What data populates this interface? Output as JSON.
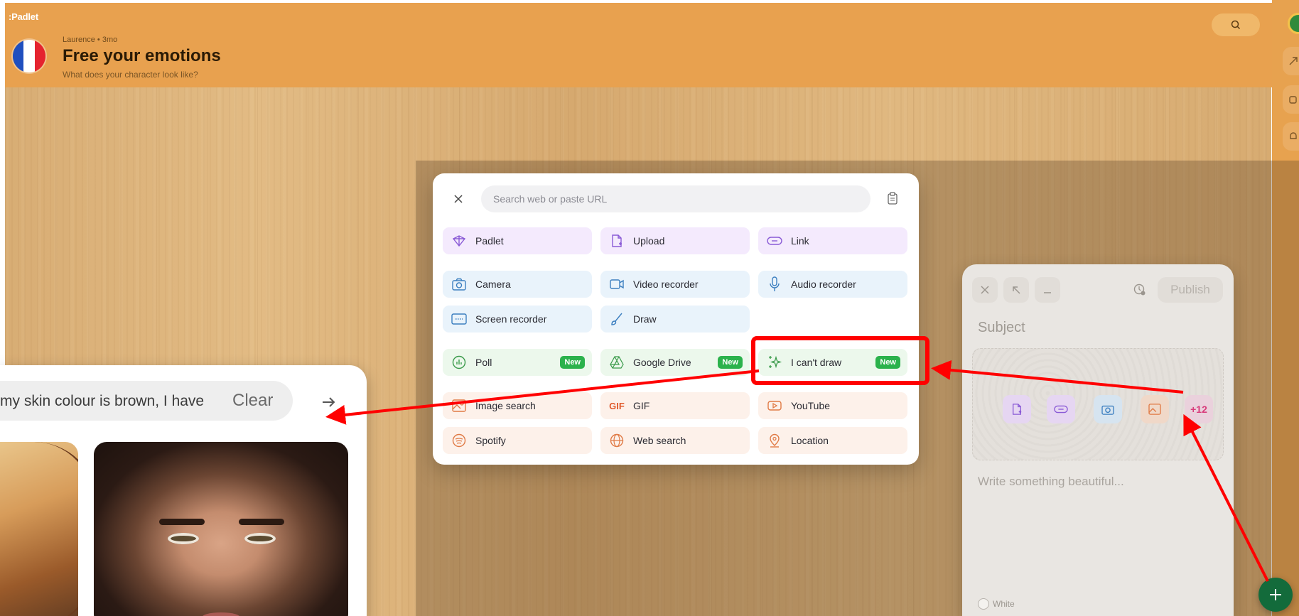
{
  "header": {
    "brand": ":Padlet",
    "byline": "Laurence • 3mo",
    "title": "Free your emotions",
    "subtitle": "What does your character look like?"
  },
  "picker": {
    "search_placeholder": "Search web or paste URL",
    "tiles": [
      {
        "label": "Padlet",
        "color": "#f4eafd",
        "icon": "padlet-icon"
      },
      {
        "label": "Upload",
        "color": "#f4eafd",
        "icon": "upload-icon"
      },
      {
        "label": "Link",
        "color": "#f4eafd",
        "icon": "link-icon"
      },
      {
        "label": "Camera",
        "color": "#e9f3fb",
        "icon": "camera-icon"
      },
      {
        "label": "Video recorder",
        "color": "#e9f3fb",
        "icon": "video-recorder-icon"
      },
      {
        "label": "Audio recorder",
        "color": "#e9f3fb",
        "icon": "microphone-icon"
      },
      {
        "label": "Screen recorder",
        "color": "#e9f3fb",
        "icon": "screen-recorder-icon"
      },
      {
        "label": "Draw",
        "color": "#e9f3fb",
        "icon": "brush-icon"
      },
      {
        "label": "Poll",
        "color": "#ecf8ec",
        "icon": "poll-icon",
        "badge": "New"
      },
      {
        "label": "Google Drive",
        "color": "#ecf8ec",
        "icon": "google-drive-icon",
        "badge": "New"
      },
      {
        "label": "I can't draw",
        "color": "#ecf8ec",
        "icon": "sparkle-icon",
        "badge": "New"
      },
      {
        "label": "Image search",
        "color": "#fdf1ea",
        "icon": "image-search-icon"
      },
      {
        "label": "GIF",
        "color": "#fdf1ea",
        "icon": "gif-icon",
        "icon_text": "GIF"
      },
      {
        "label": "YouTube",
        "color": "#fdf1ea",
        "icon": "youtube-icon"
      },
      {
        "label": "Spotify",
        "color": "#fdf1ea",
        "icon": "spotify-icon"
      },
      {
        "label": "Web search",
        "color": "#fdf1ea",
        "icon": "globe-icon"
      },
      {
        "label": "Location",
        "color": "#fdf1ea",
        "icon": "location-pin-icon"
      }
    ]
  },
  "ai_panel": {
    "prompt_text": "my skin colour is brown, I have",
    "clear_label": "Clear"
  },
  "composer": {
    "publish_label": "Publish",
    "subject_placeholder": "Subject",
    "more_count": "+12",
    "body_placeholder": "Write something beautiful...",
    "color_label": "White"
  },
  "colors": {
    "header": "#e8a14f",
    "fab": "#136b3b",
    "annotation": "#ff0000",
    "new_badge": "#2bb24c"
  }
}
